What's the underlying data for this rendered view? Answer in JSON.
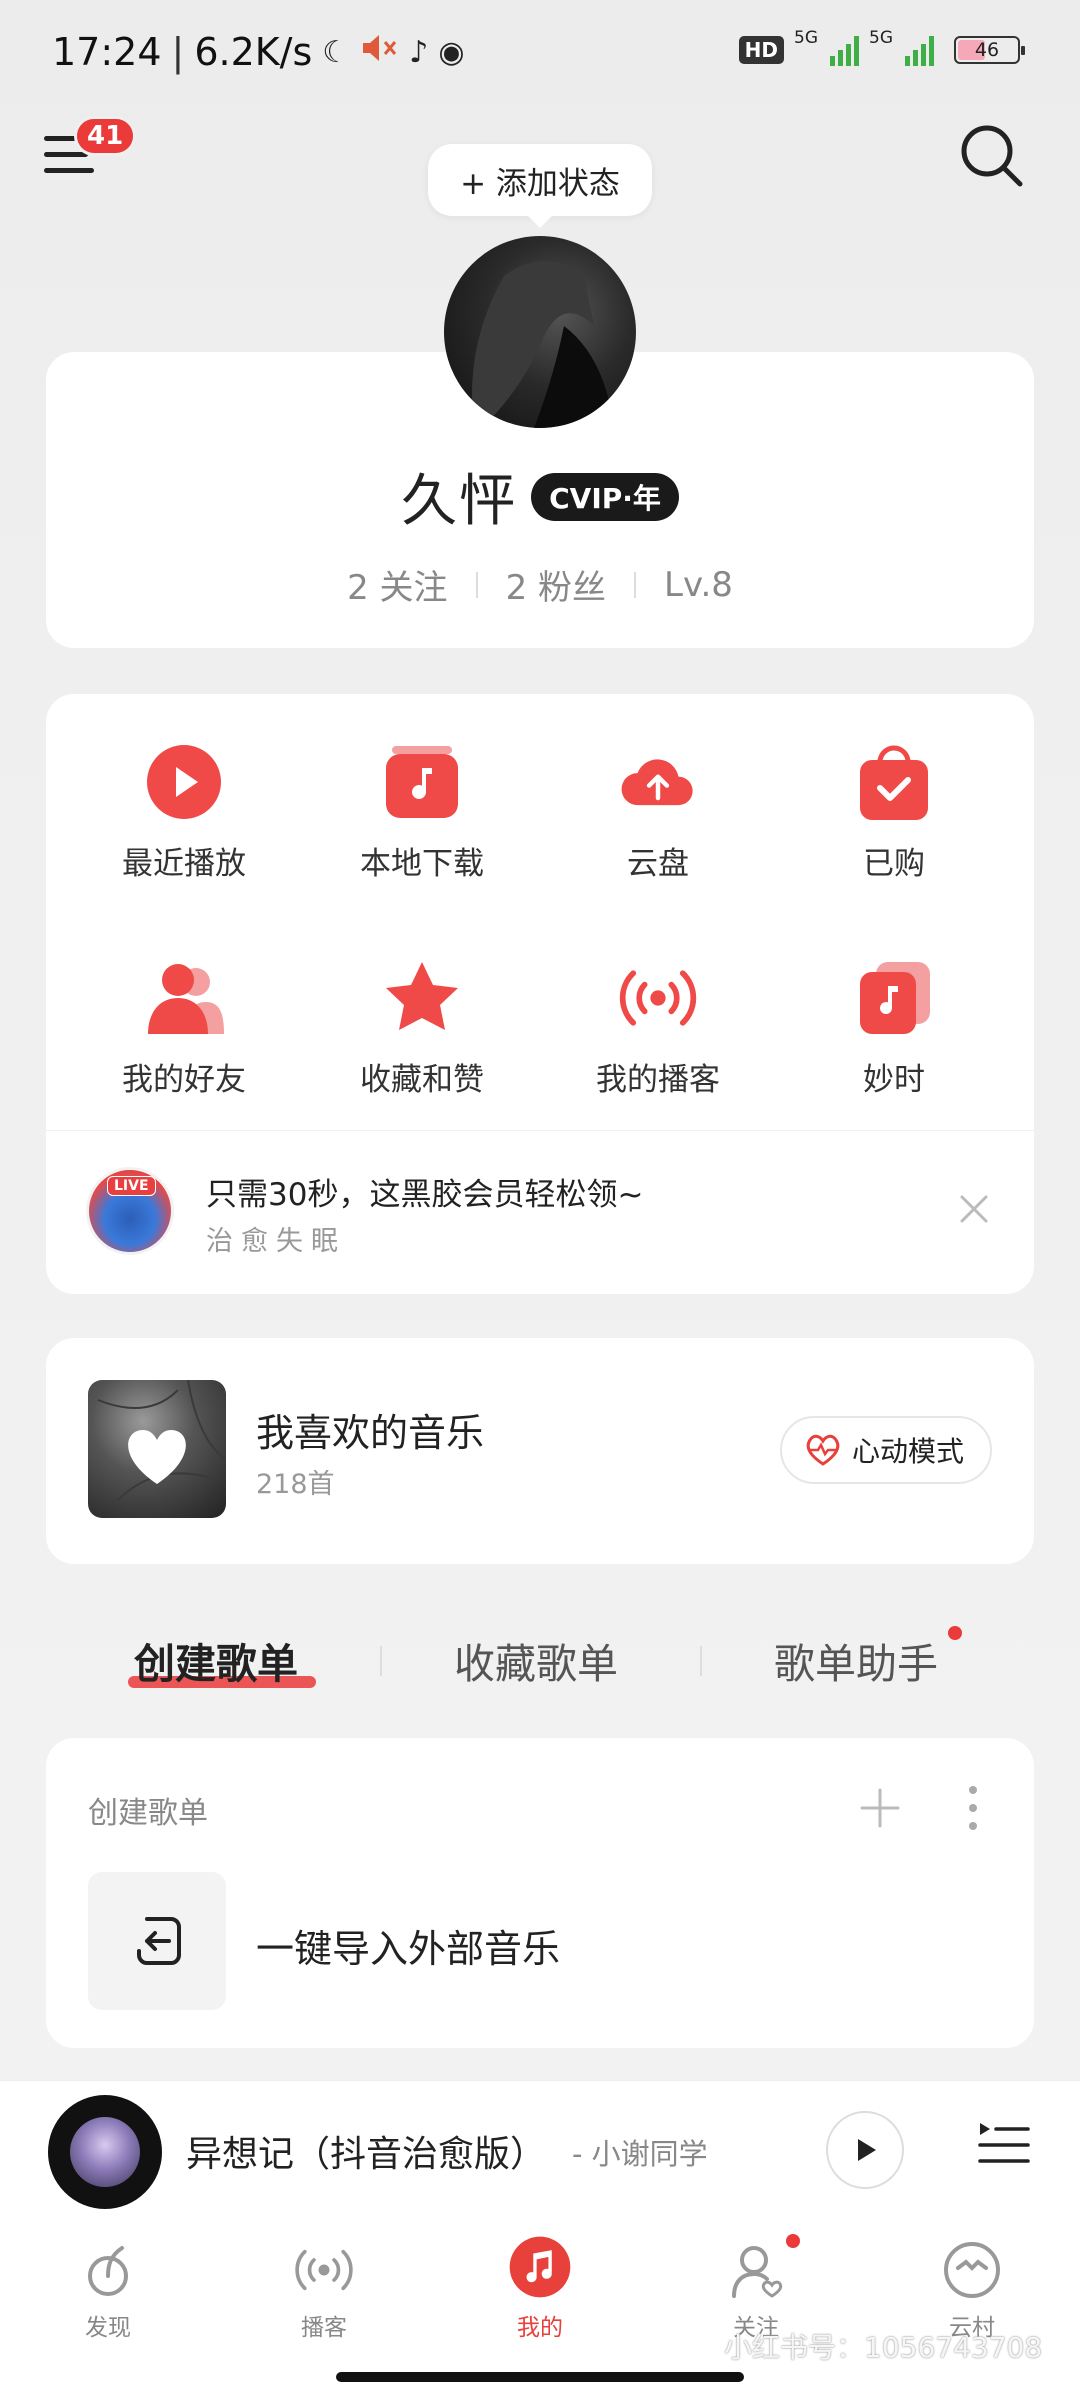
{
  "status_bar": {
    "time": "17:24",
    "net_speed": "6.2K/s",
    "hd_label": "HD",
    "signal_1": "5G",
    "signal_2": "5G",
    "battery": "46",
    "battery_level": 0.46
  },
  "header": {
    "menu_badge": "41",
    "add_status_label": "+ 添加状态"
  },
  "profile": {
    "name": "久怦",
    "vip_label": "CVIP·年",
    "following": "2 关注",
    "followers": "2 粉丝",
    "level": "Lv.8"
  },
  "quick_actions": [
    {
      "label": "最近播放",
      "icon": "play-circle-icon"
    },
    {
      "label": "本地下载",
      "icon": "music-box-icon"
    },
    {
      "label": "云盘",
      "icon": "cloud-upload-icon"
    },
    {
      "label": "已购",
      "icon": "shopping-bag-icon"
    },
    {
      "label": "我的好友",
      "icon": "friends-icon"
    },
    {
      "label": "收藏和赞",
      "icon": "star-icon"
    },
    {
      "label": "我的播客",
      "icon": "broadcast-icon"
    },
    {
      "label": "妙时",
      "icon": "music-card-icon"
    }
  ],
  "promo": {
    "badge": "LIVE",
    "title": "只需30秒，这黑胶会员轻松领~",
    "subtitle": "治愈失眠"
  },
  "liked_music": {
    "title": "我喜欢的音乐",
    "count": "218首",
    "heart_mode_label": "心动模式"
  },
  "playlist_tabs": [
    {
      "label": "创建歌单",
      "active": true
    },
    {
      "label": "收藏歌单",
      "active": false
    },
    {
      "label": "歌单助手",
      "active": false,
      "dot": true
    }
  ],
  "created_section": {
    "label": "创建歌单",
    "import_label": "一键导入外部音乐"
  },
  "mini_player": {
    "title": "异想记（抖音治愈版）",
    "artist": "- 小谢同学"
  },
  "bottom_nav": [
    {
      "label": "发现",
      "icon": "discover-icon",
      "active": false
    },
    {
      "label": "播客",
      "icon": "podcast-icon",
      "active": false
    },
    {
      "label": "我的",
      "icon": "music-note-icon",
      "active": true
    },
    {
      "label": "关注",
      "icon": "follow-icon",
      "active": false,
      "dot": true
    },
    {
      "label": "云村",
      "icon": "cloud-village-icon",
      "active": false
    }
  ],
  "watermark": "小红书号：1056743708",
  "colors": {
    "accent": "#e8403a",
    "background": "#efefef",
    "card": "#ffffff"
  }
}
